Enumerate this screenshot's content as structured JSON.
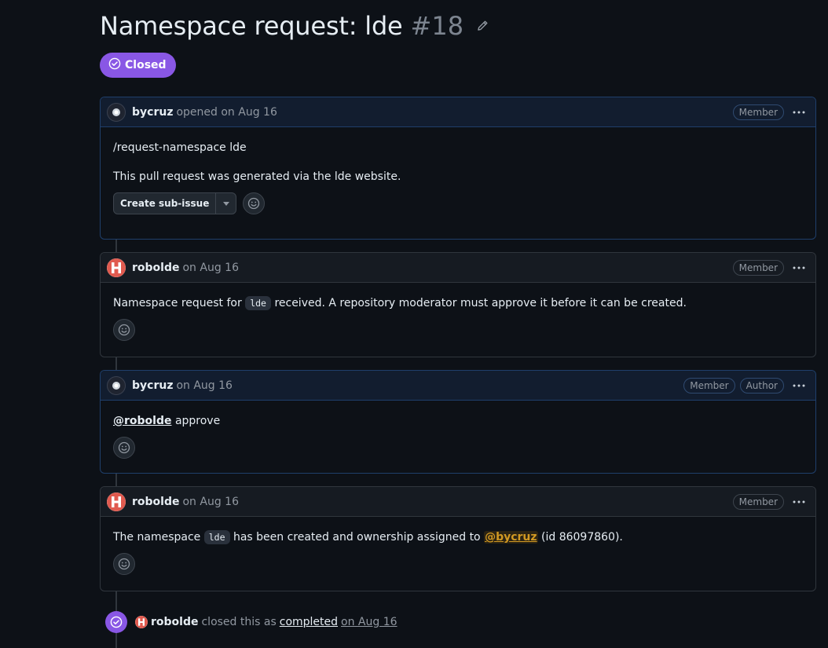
{
  "issue": {
    "title": "Namespace request: lde",
    "number": "#18",
    "state": "Closed"
  },
  "comments": [
    {
      "author": "bycruz",
      "meta": "opened on Aug 16",
      "roles": [
        "Member"
      ],
      "body": {
        "line1": "/request-namespace lde",
        "line2": "This pull request was generated via the lde website."
      },
      "actions": {
        "create_sub_issue": "Create sub-issue"
      }
    },
    {
      "author": "robolde",
      "meta": "on Aug 16",
      "roles": [
        "Member"
      ],
      "body": {
        "pre": "Namespace request for",
        "code": "lde",
        "post": "received. A repository moderator must approve it before it can be created."
      }
    },
    {
      "author": "bycruz",
      "meta": "on Aug 16",
      "roles": [
        "Member",
        "Author"
      ],
      "body": {
        "mention": "@robolde",
        "post": "approve"
      }
    },
    {
      "author": "robolde",
      "meta": "on Aug 16",
      "roles": [
        "Member"
      ],
      "body": {
        "pre": "The namespace",
        "code": "lde",
        "mid": "has been created and ownership assigned to",
        "mention": "@bycruz",
        "post": "(id 86097860)."
      }
    }
  ],
  "event": {
    "actor": "robolde",
    "text": "closed this as",
    "link": "completed",
    "date": "on Aug 16"
  },
  "colors": {
    "closed": "#8957e5",
    "background": "#0d1117",
    "mention_highlight": "#d29922"
  }
}
